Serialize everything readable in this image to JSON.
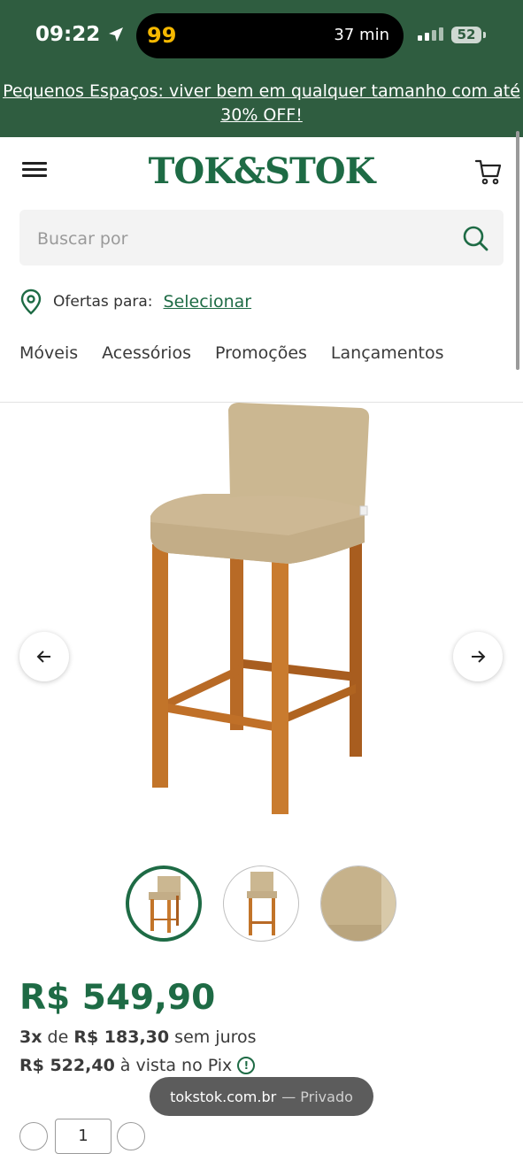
{
  "status_bar": {
    "time": "09:22",
    "app_badge": "99",
    "island_text": "37 min",
    "battery": "52"
  },
  "promo_banner": "Pequenos Espaços: viver bem em qualquer tamanho com até 30% OFF!",
  "header": {
    "logo_text": "TOK&STOK",
    "brand_color": "#1e6b45"
  },
  "search": {
    "placeholder": "Buscar por"
  },
  "location": {
    "label": "Ofertas para:",
    "link": "Selecionar"
  },
  "nav": {
    "items": [
      "Móveis",
      "Acessórios",
      "Promoções",
      "Lançamentos"
    ]
  },
  "product": {
    "price": "R$ 549,90",
    "installments_count": "3x",
    "installments_of": "de",
    "installment_value": "R$ 183,30",
    "installment_suffix": "sem juros",
    "pix_price": "R$ 522,40",
    "pix_suffix": "à vista no Pix",
    "quantity": "1"
  },
  "browser": {
    "url": "tokstok.com.br",
    "mode": "— Privado"
  },
  "icons": {
    "menu": "hamburger-menu-icon",
    "cart": "cart-icon",
    "search": "search-icon",
    "location": "location-pin-icon",
    "prev": "arrow-left-icon",
    "next": "arrow-right-icon",
    "info": "info-icon"
  }
}
